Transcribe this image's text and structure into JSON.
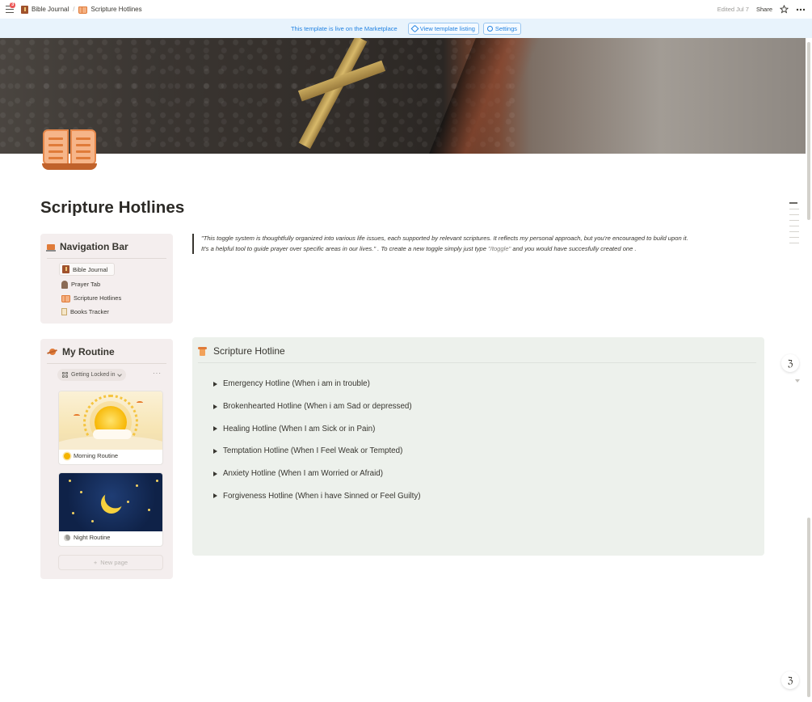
{
  "topbar": {
    "notification_count": "3",
    "breadcrumbs": [
      {
        "label": "Bible Journal",
        "icon": "bible-icon"
      },
      {
        "label": "Scripture Hotlines",
        "icon": "open-book-icon"
      }
    ],
    "edited": "Edited Jul 7",
    "share_label": "Share"
  },
  "banner": {
    "text": "This template is live on the Marketplace",
    "view_listing_label": "View template listing",
    "settings_label": "Settings"
  },
  "page": {
    "title": "Scripture Hotlines",
    "icon": "open-book-icon"
  },
  "navigation": {
    "title": "Navigation Bar",
    "items": [
      {
        "label": "Bible Journal",
        "icon": "bible-icon"
      },
      {
        "label": "Prayer Tab",
        "icon": "praying-icon"
      },
      {
        "label": "Scripture Hotlines",
        "icon": "open-book-icon"
      },
      {
        "label": "Books Tracker",
        "icon": "ledger-icon"
      }
    ]
  },
  "routine": {
    "title": "My Routine",
    "view_label": "Getting Locked in",
    "cards": [
      {
        "label": "Morning Routine",
        "icon": "sun-icon"
      },
      {
        "label": "Night Routine",
        "icon": "moon-icon"
      }
    ],
    "new_page_label": "New page"
  },
  "quote": {
    "line1": "\"This toggle system is thoughtfully organized into various life issues, each supported by relevant scriptures. It reflects my personal approach, but you're encouraged to build upon it.",
    "line2_a": "It's a helpful tool to guide prayer over specific areas in our lives.\" . To create a new toggle simply just type ",
    "line2_code": "\"/toggle\"",
    "line2_b": "  and you would have succesfully  created one ."
  },
  "hotline": {
    "title": "Scripture Hotline",
    "toggles": [
      "Emergency Hotline (When i am in trouble)",
      "Brokenhearted  Hotline (When i am Sad or depressed)",
      "Healing Hotline (When I am Sick or in Pain)",
      "Temptation Hotline (When I Feel Weak or Tempted)",
      "Anxiety Hotline (When I am Worried or Afraid)",
      "Forgiveness Hotline (When i have Sinned or Feel Guilty)"
    ]
  },
  "colors": {
    "accent_blue": "#2383e2",
    "banner_bg": "#e8f3fc",
    "card_bg": "#f4eeee",
    "hotline_bg": "#edf1ec"
  }
}
